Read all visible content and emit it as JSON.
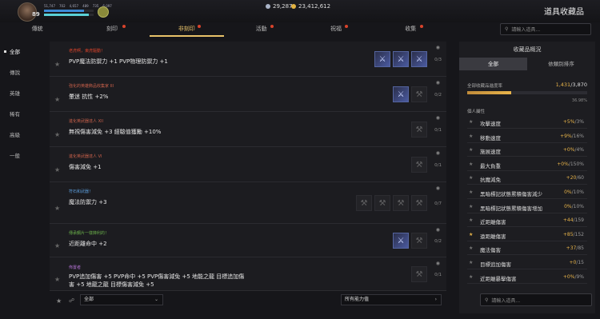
{
  "header": {
    "level": "89",
    "stats": [
      "51,747",
      "702",
      "4,657",
      "489",
      "735",
      "6,097"
    ],
    "currency_1": "29,287",
    "currency_2": "23,412,612",
    "title": "道具收藏品",
    "hp_fill": 0.8,
    "mp_fill": 0.9,
    "colors": {
      "hp": "#3d8bd6",
      "mp": "#5ad0d6",
      "gem": "#aab4c8",
      "gold": "#e3b341"
    }
  },
  "tabs": [
    {
      "label": "傳統",
      "badge": false
    },
    {
      "label": "刻印",
      "badge": true
    },
    {
      "label": "非刻印",
      "badge": true,
      "active": true
    },
    {
      "label": "活動",
      "badge": true
    },
    {
      "label": "祝福",
      "badge": true
    },
    {
      "label": "收集",
      "badge": true
    }
  ],
  "search_top": {
    "placeholder": "請輸入道具..."
  },
  "sidebar": [
    "全部",
    "傳說",
    "英雄",
    "稀有",
    "高級",
    "一般"
  ],
  "rows": [
    {
      "sub": "老虎啊，東虎驅動！",
      "sub_color": "#d9432b",
      "main": "PVP魔法防禦力 +1 PVP物理防禦力 +1",
      "count": "0/3",
      "items": [
        "blue",
        "blue",
        "blue"
      ]
    },
    {
      "sub": "強化的英雄飾品收集家 III",
      "sub_color": "#c8604a",
      "main": "暈迷 抗性 +2%",
      "count": "0/2",
      "items": [
        "blue",
        "dim"
      ]
    },
    {
      "sub": "進化英武器達人 XII",
      "sub_color": "#c8604a",
      "main": "無視傷害減免 +3 經驗值獲勵 +10%",
      "count": "0/1",
      "items": [
        "dim"
      ]
    },
    {
      "sub": "進化英武器達人 VI",
      "sub_color": "#c8604a",
      "main": "傷害減免 +1",
      "count": "0/1",
      "items": [
        "dim"
      ]
    },
    {
      "sub": "符石和武器！",
      "sub_color": "#5a9ad6",
      "main": "魔法防禦力 +3",
      "count": "0/7",
      "items": [
        "dim",
        "dim",
        "dim",
        "dim"
      ]
    },
    {
      "sub": "傳承鋼片一樣鋒利的！",
      "sub_color": "#6ab04a",
      "main": "近距離命中 +2",
      "count": "0/2",
      "items": [
        "blue",
        "dim"
      ]
    },
    {
      "sub": "佈置者",
      "sub_color": "#b070d0",
      "main": "PVP追加傷害 +5 PVP命中 +5 PVP傷害減免 +5 地能之龍 目標追加傷害 +5 地龍之龍 目標傷害減免 +5",
      "count": "0/1",
      "items": [
        "dim"
      ]
    }
  ],
  "bottom": {
    "filter": "全部",
    "power": "所有能力值"
  },
  "panel": {
    "title": "收藏品概況",
    "tab_all": "全部",
    "tab_sort": "依類別排序",
    "total_label": "全部收藏品進度率",
    "total_done": "1,431",
    "total_max": "/3,870",
    "progress": 0.3698,
    "pct": "36.98%",
    "section": "個人屬性",
    "stats": [
      {
        "name": "攻擊速度",
        "val": "+5%",
        "max": "/3%",
        "fav": false
      },
      {
        "name": "移動速度",
        "val": "+9%",
        "max": "/16%",
        "fav": false
      },
      {
        "name": "施展速度",
        "val": "+0%",
        "max": "/4%",
        "fav": false
      },
      {
        "name": "最大負重",
        "val": "+0%",
        "max": "/150%",
        "fav": false
      },
      {
        "name": "抗魔減免",
        "val": "+20",
        "max": "/60",
        "fav": false
      },
      {
        "name": "黑暗標記狀態累積傷害減少",
        "val": "0%",
        "max": "/10%",
        "fav": false
      },
      {
        "name": "黑暗標記狀態累積傷害增加",
        "val": "0%",
        "max": "/10%",
        "fav": false
      },
      {
        "name": "近距離傷害",
        "val": "+44",
        "max": "/159",
        "fav": false
      },
      {
        "name": "遠距離傷害",
        "val": "+85",
        "max": "/152",
        "fav": true
      },
      {
        "name": "魔法傷害",
        "val": "+37",
        "max": "/85",
        "fav": false
      },
      {
        "name": "目標追加傷害",
        "val": "+0",
        "max": "/15",
        "fav": false
      },
      {
        "name": "近距離暴擊傷害",
        "val": "+0%",
        "max": "/9%",
        "fav": false
      }
    ]
  },
  "search_bot": {
    "placeholder": "請輸入道具..."
  }
}
